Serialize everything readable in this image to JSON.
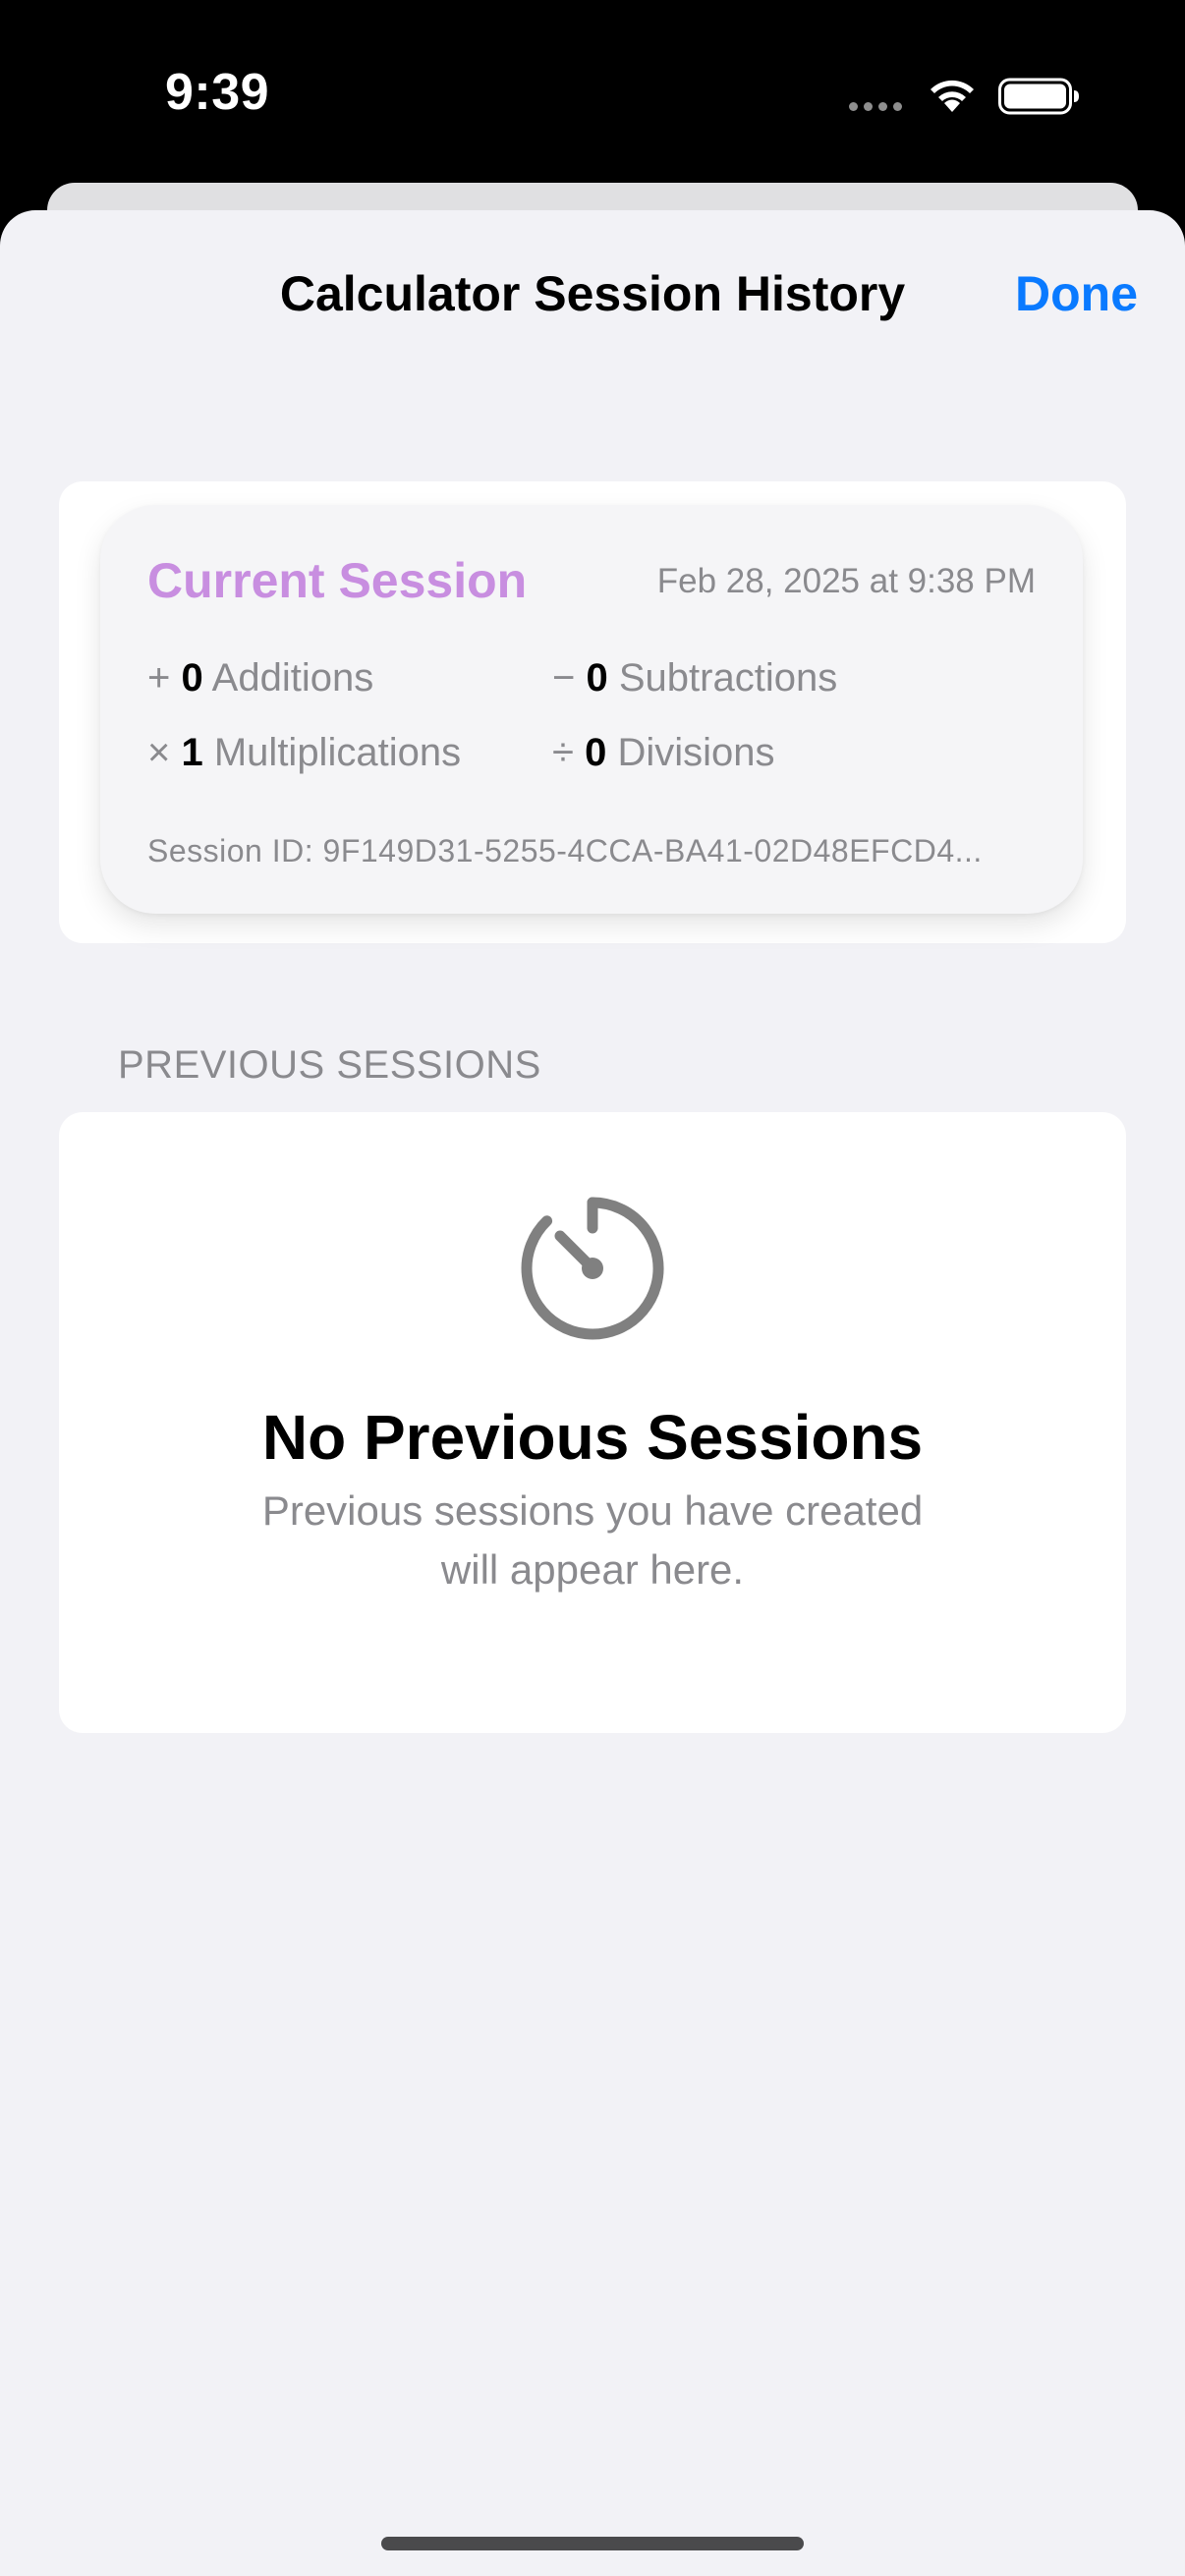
{
  "status_bar": {
    "time": "9:39"
  },
  "nav": {
    "title": "Calculator Session History",
    "done_label": "Done"
  },
  "current_session": {
    "title": "Current Session",
    "date": "Feb 28, 2025 at 9:38 PM",
    "stats": {
      "additions": {
        "symbol": "+",
        "count": "0",
        "label": "Additions"
      },
      "subtractions": {
        "symbol": "−",
        "count": "0",
        "label": "Subtractions"
      },
      "multiplications": {
        "symbol": "×",
        "count": "1",
        "label": "Multiplications"
      },
      "divisions": {
        "symbol": "÷",
        "count": "0",
        "label": "Divisions"
      }
    },
    "session_id": "Session ID: 9F149D31-5255-4CCA-BA41-02D48EFCD4..."
  },
  "previous_sessions": {
    "header": "PREVIOUS SESSIONS",
    "empty_icon": "timer-icon",
    "empty_title": "No Previous Sessions",
    "empty_subtitle": "Previous sessions you have created will appear here."
  },
  "colors": {
    "accent_blue": "#0a7aff",
    "session_title_purple": "#c88ee0",
    "secondary_text": "#8a8a8e",
    "sheet_background": "#f2f2f6"
  }
}
